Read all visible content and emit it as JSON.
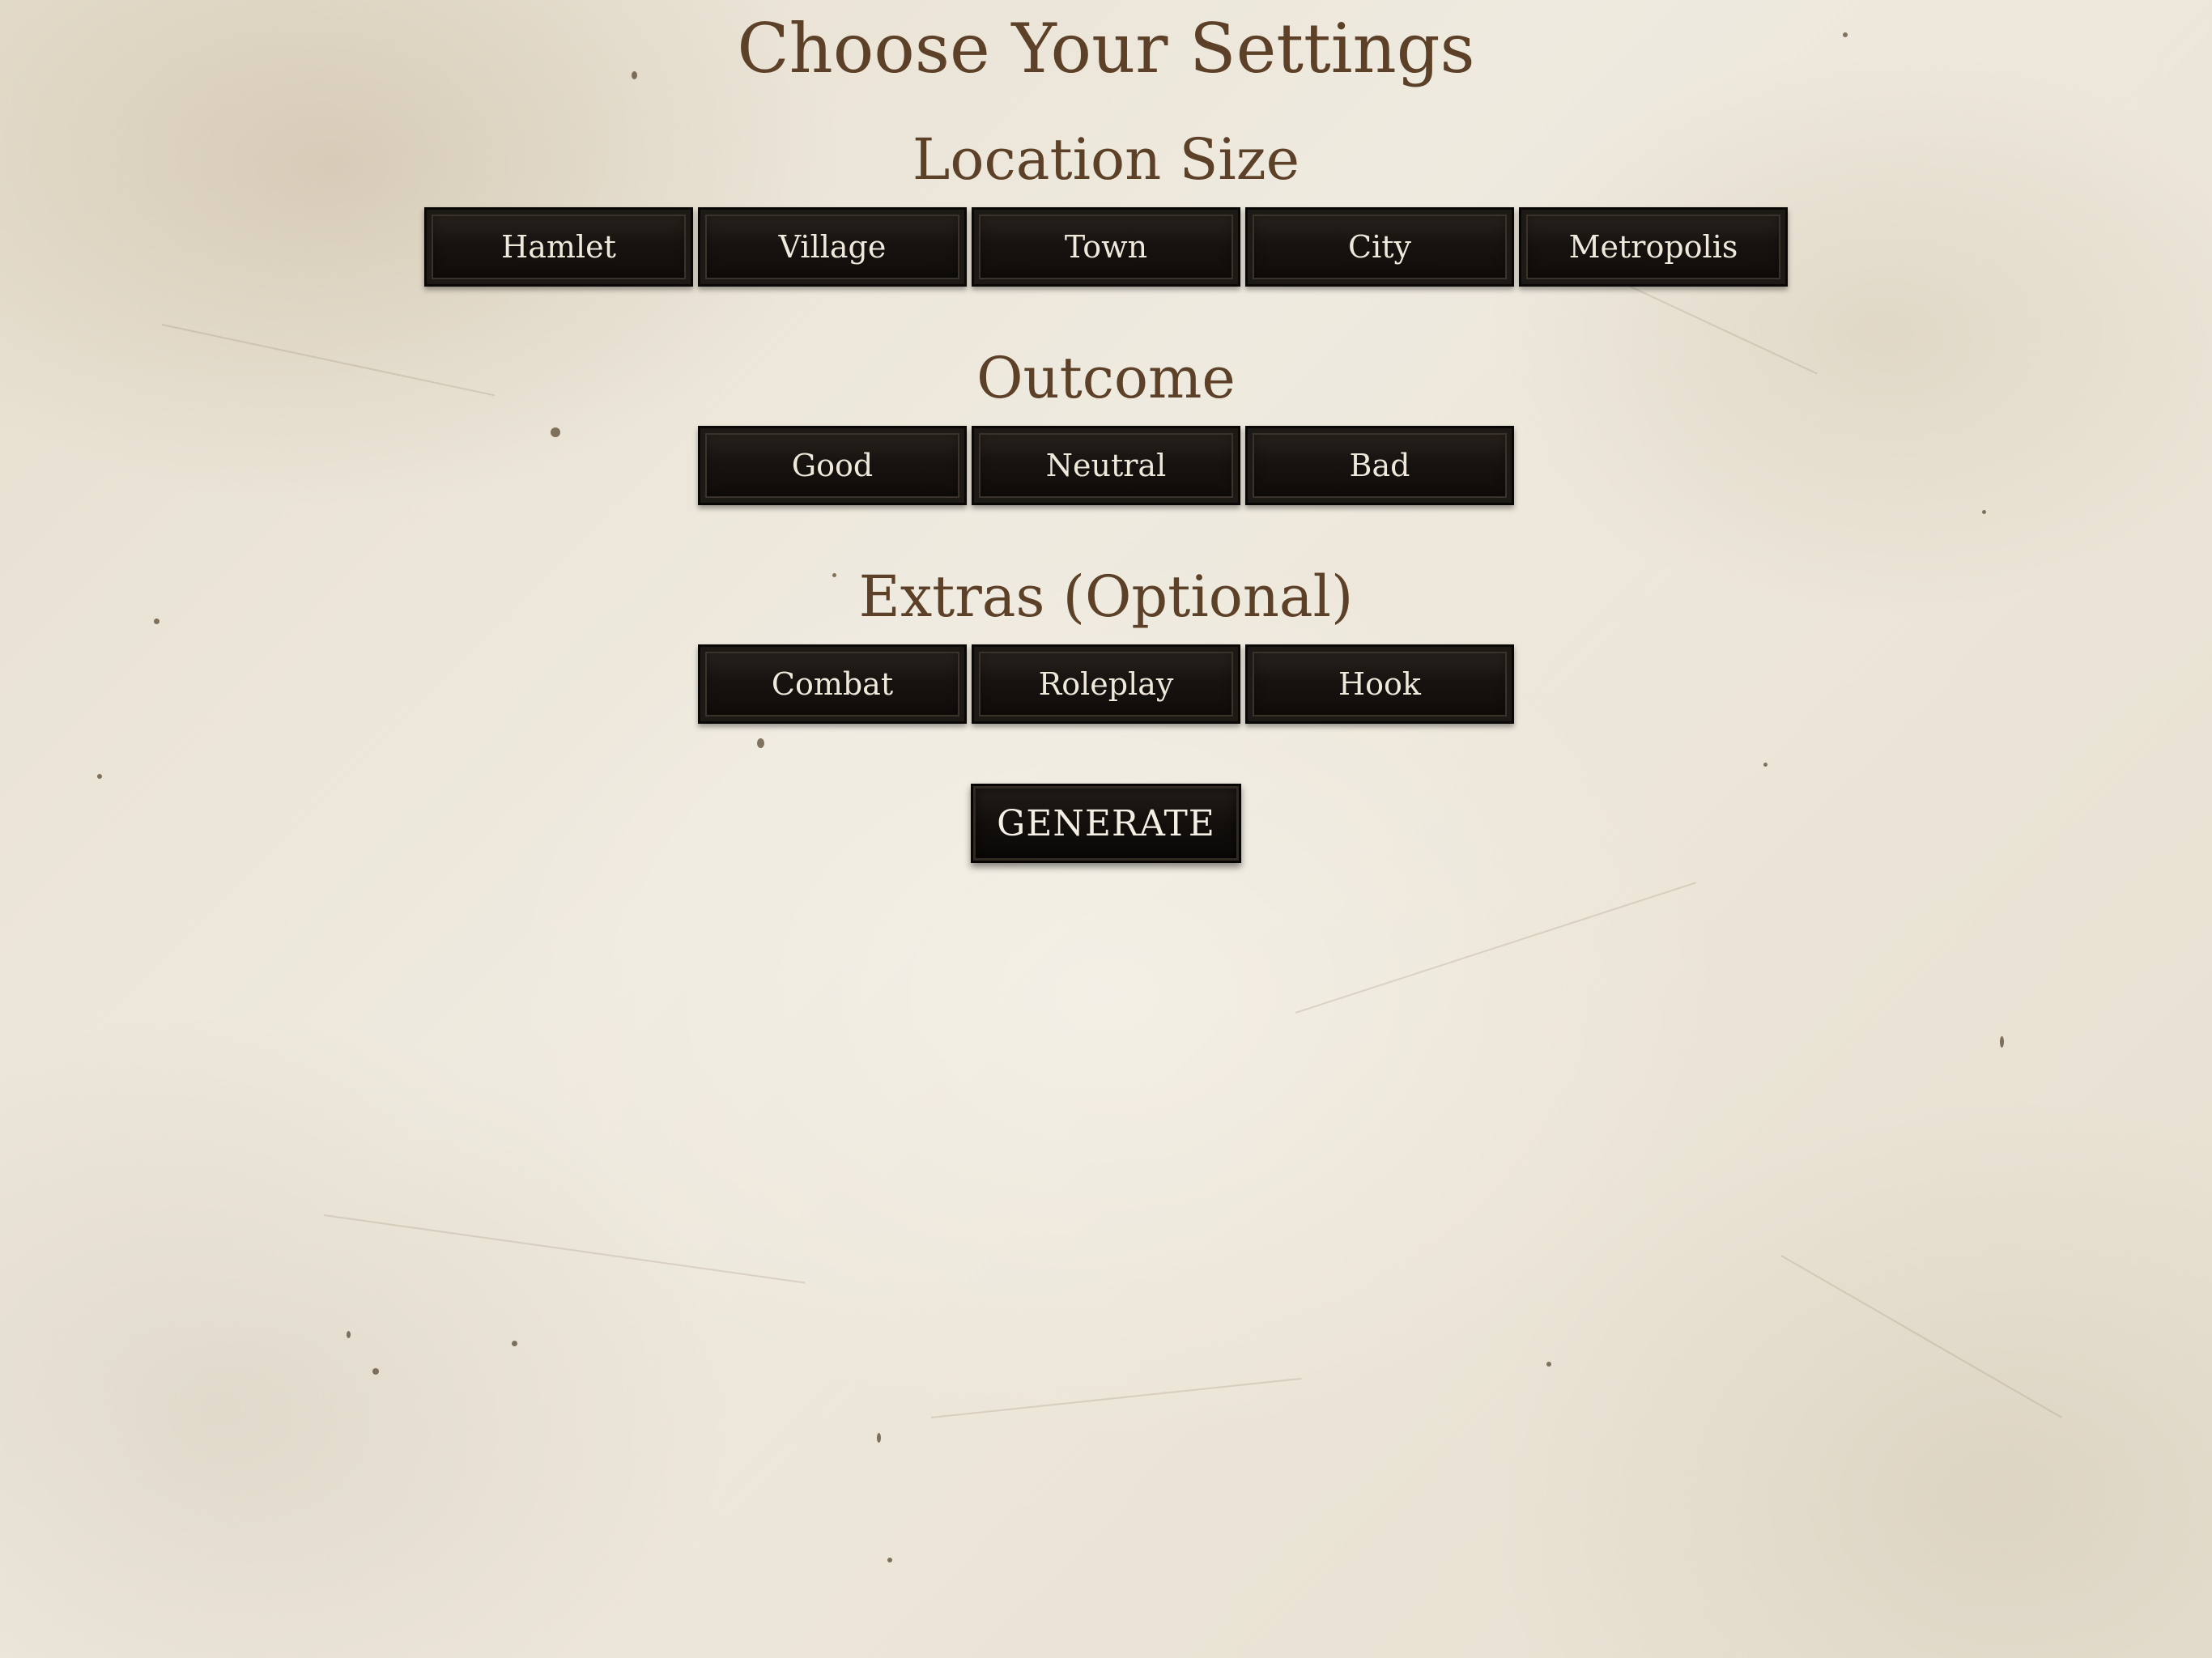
{
  "page": {
    "title": "Choose Your Settings"
  },
  "sections": {
    "location_size": {
      "heading": "Location Size",
      "options": [
        "Hamlet",
        "Village",
        "Town",
        "City",
        "Metropolis"
      ]
    },
    "outcome": {
      "heading": "Outcome",
      "options": [
        "Good",
        "Neutral",
        "Bad"
      ]
    },
    "extras": {
      "heading": "Extras (Optional)",
      "options": [
        "Combat",
        "Roleplay",
        "Hook"
      ]
    }
  },
  "actions": {
    "generate_label": "GENERATE"
  },
  "colors": {
    "heading_text": "#5c4128",
    "button_background": "#171310",
    "button_text": "#efe9dc",
    "parchment": "#ece6d9"
  }
}
